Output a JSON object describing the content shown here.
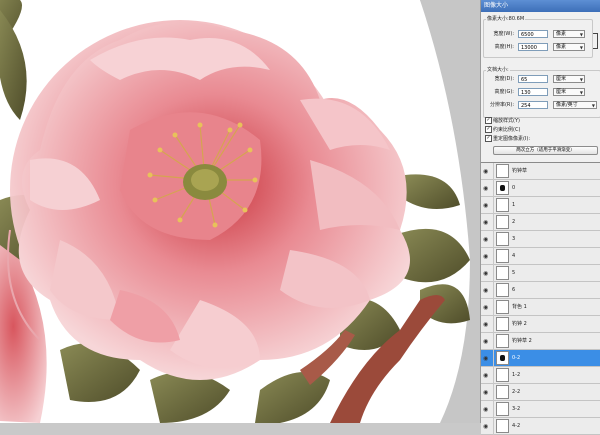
{
  "dialog": {
    "title": "图像大小",
    "pixel_dimensions_label": "像素大小:80.6M",
    "width_label": "宽度(W):",
    "width_value": "6500",
    "width_unit": "像素",
    "height_label": "高度(H):",
    "height_value": "13000",
    "height_unit": "像素",
    "document_size_label": "文档大小:",
    "doc_width_label": "宽度(D):",
    "doc_width_value": "65",
    "doc_width_unit": "厘米",
    "doc_height_label": "高度(G):",
    "doc_height_value": "130",
    "doc_height_unit": "厘米",
    "resolution_label": "分辨率(R):",
    "resolution_value": "254",
    "resolution_unit": "像素/英寸",
    "scale_styles": "缩放样式(Y)",
    "constrain_proportions": "约束比例(C)",
    "resample": "重定图像像素(I):",
    "resample_method": "两次立方（适用于平滑渐变）"
  },
  "layers": [
    {
      "name": "钓钟草",
      "icon": "leaf-thumb"
    },
    {
      "name": "0",
      "icon": "mask-thumb"
    },
    {
      "name": "1",
      "icon": "leaf-thumb"
    },
    {
      "name": "2",
      "icon": "leaf-thumb"
    },
    {
      "name": "3",
      "icon": "leaf-thumb"
    },
    {
      "name": "4",
      "icon": "leaf-thumb"
    },
    {
      "name": "5",
      "icon": "leaf-thumb"
    },
    {
      "name": "6",
      "icon": "leaf-thumb"
    },
    {
      "name": "背色 1",
      "icon": "blank-thumb"
    },
    {
      "name": "钓钟 2",
      "icon": "leaf-thumb"
    },
    {
      "name": "钓钟草 2",
      "icon": "leaf-thumb"
    },
    {
      "name": "0-2",
      "icon": "mask-thumb",
      "selected": true
    },
    {
      "name": "1-2",
      "icon": "leaf-thumb"
    },
    {
      "name": "2-2",
      "icon": "leaf-thumb"
    },
    {
      "name": "3-2",
      "icon": "leaf-thumb"
    },
    {
      "name": "4-2",
      "icon": "leaf-thumb"
    }
  ],
  "colors": {
    "accent": "#3b8ee6",
    "title_bar": "#4a7cc4",
    "petal_light": "#f4c8cc",
    "petal_dark": "#c8323a",
    "leaf": "#6b6a3a"
  }
}
